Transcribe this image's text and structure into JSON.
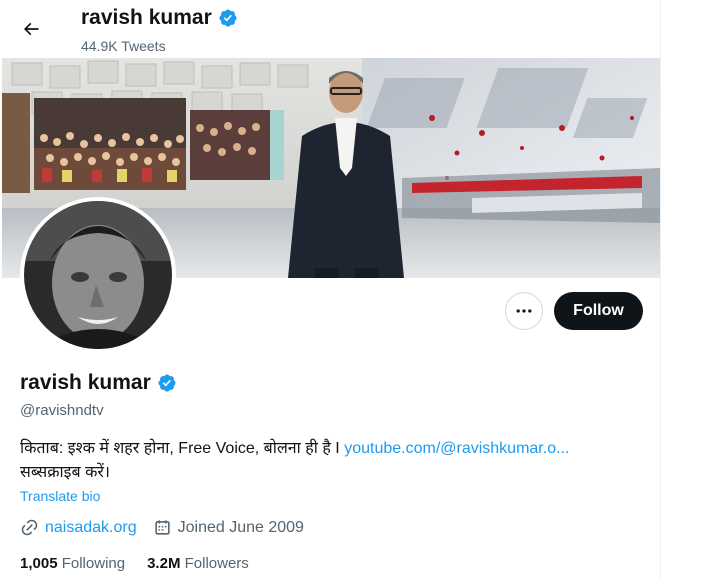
{
  "header": {
    "name": "ravish kumar",
    "tweet_count": "44.9K Tweets"
  },
  "profile": {
    "display_name": "ravish kumar",
    "handle": "@ravishndtv",
    "bio_text": "किताब: इश्क में शहर होना, Free Voice, बोलना ही है I",
    "bio_link": "youtube.com/@ravishkumar.o...",
    "bio_line2": "सब्सक्राइब करें।",
    "translate_label": "Translate bio",
    "website": "naisadak.org",
    "joined": "Joined June 2009",
    "following_count": "1,005",
    "following_label": "Following",
    "followers_count": "3.2M",
    "followers_label": "Followers"
  },
  "actions": {
    "follow_label": "Follow"
  },
  "colors": {
    "accent": "#1d9bf0",
    "text": "#0f1419",
    "muted": "#536471",
    "verified": "#1d9bf0"
  },
  "icons": [
    "back-arrow-icon",
    "verified-badge-icon",
    "more-options-icon",
    "link-icon",
    "calendar-icon"
  ]
}
